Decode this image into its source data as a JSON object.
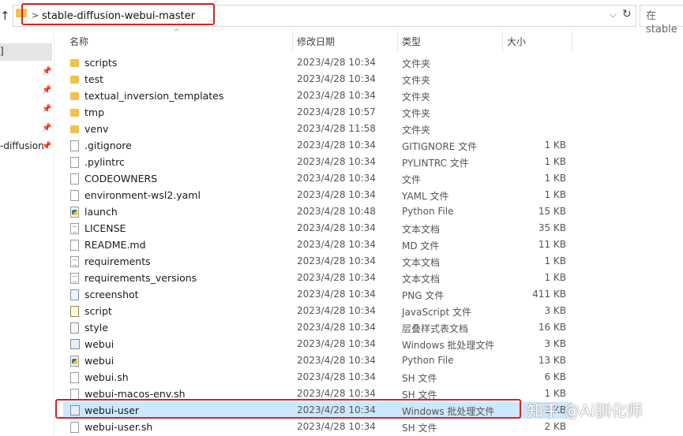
{
  "address_bar": {
    "up_icon": "up-arrow-icon",
    "folder_icon": "folder-icon",
    "chevron": ">",
    "path": "stable-diffusion-webui-master",
    "dropdown_glyph": "⌵",
    "refresh_glyph": "↻",
    "search_placeholder": "在 stable"
  },
  "nav": {
    "items": [
      {
        "label": "]",
        "selected": true
      },
      {
        "label": "",
        "pinned": true
      },
      {
        "label": "",
        "pinned": true
      },
      {
        "label": "",
        "pinned": true
      },
      {
        "label": "",
        "pinned": true
      },
      {
        "label": "-diffusion",
        "pinned": true
      }
    ]
  },
  "columns": {
    "name": "名称",
    "date": "修改日期",
    "type": "类型",
    "size": "大小"
  },
  "files": [
    {
      "name": "scripts",
      "date": "2023/4/28 10:34",
      "type": "文件夹",
      "size": "",
      "icon": "folder-icon"
    },
    {
      "name": "test",
      "date": "2023/4/28 10:34",
      "type": "文件夹",
      "size": "",
      "icon": "folder-icon"
    },
    {
      "name": "textual_inversion_templates",
      "date": "2023/4/28 10:34",
      "type": "文件夹",
      "size": "",
      "icon": "folder-icon"
    },
    {
      "name": "tmp",
      "date": "2023/4/28 10:57",
      "type": "文件夹",
      "size": "",
      "icon": "folder-icon"
    },
    {
      "name": "venv",
      "date": "2023/4/28 11:58",
      "type": "文件夹",
      "size": "",
      "icon": "folder-icon"
    },
    {
      "name": ".gitignore",
      "date": "2023/4/28 10:34",
      "type": "GITIGNORE 文件",
      "size": "1 KB",
      "icon": "file-icon"
    },
    {
      "name": ".pylintrc",
      "date": "2023/4/28 10:34",
      "type": "PYLINTRC 文件",
      "size": "1 KB",
      "icon": "file-icon"
    },
    {
      "name": "CODEOWNERS",
      "date": "2023/4/28 10:34",
      "type": "文件",
      "size": "1 KB",
      "icon": "file-icon"
    },
    {
      "name": "environment-wsl2.yaml",
      "date": "2023/4/28 10:34",
      "type": "YAML 文件",
      "size": "1 KB",
      "icon": "file-icon"
    },
    {
      "name": "launch",
      "date": "2023/4/28 10:48",
      "type": "Python File",
      "size": "15 KB",
      "icon": "python-file-icon"
    },
    {
      "name": "LICENSE",
      "date": "2023/4/28 10:34",
      "type": "文本文档",
      "size": "35 KB",
      "icon": "text-file-icon"
    },
    {
      "name": "README.md",
      "date": "2023/4/28 10:34",
      "type": "MD 文件",
      "size": "11 KB",
      "icon": "file-icon"
    },
    {
      "name": "requirements",
      "date": "2023/4/28 10:34",
      "type": "文本文档",
      "size": "1 KB",
      "icon": "text-file-icon"
    },
    {
      "name": "requirements_versions",
      "date": "2023/4/28 10:34",
      "type": "文本文档",
      "size": "1 KB",
      "icon": "text-file-icon"
    },
    {
      "name": "screenshot",
      "date": "2023/4/28 10:34",
      "type": "PNG 文件",
      "size": "411 KB",
      "icon": "image-file-icon"
    },
    {
      "name": "script",
      "date": "2023/4/28 10:34",
      "type": "JavaScript 文件",
      "size": "3 KB",
      "icon": "javascript-file-icon"
    },
    {
      "name": "style",
      "date": "2023/4/28 10:34",
      "type": "层叠样式表文档",
      "size": "16 KB",
      "icon": "css-file-icon"
    },
    {
      "name": "webui",
      "date": "2023/4/28 10:34",
      "type": "Windows 批处理文件",
      "size": "3 KB",
      "icon": "batch-file-icon"
    },
    {
      "name": "webui",
      "date": "2023/4/28 10:34",
      "type": "Python File",
      "size": "13 KB",
      "icon": "python-file-icon"
    },
    {
      "name": "webui.sh",
      "date": "2023/4/28 10:34",
      "type": "SH 文件",
      "size": "6 KB",
      "icon": "file-icon"
    },
    {
      "name": "webui-macos-env.sh",
      "date": "2023/4/28 10:34",
      "type": "SH 文件",
      "size": "1 KB",
      "icon": "file-icon"
    },
    {
      "name": "webui-user",
      "date": "2023/4/28 10:34",
      "type": "Windows 批处理文件",
      "size": "1 KB",
      "icon": "batch-file-icon",
      "selected": true
    },
    {
      "name": "webui-user.sh",
      "date": "2023/4/28 10:34",
      "type": "SH 文件",
      "size": "2 KB",
      "icon": "file-icon"
    }
  ],
  "colors": {
    "selection": "#cce8ff",
    "highlight_box": "#e02020",
    "folder": "#f0c24d"
  },
  "watermark": "知乎 @Ai驯化师"
}
